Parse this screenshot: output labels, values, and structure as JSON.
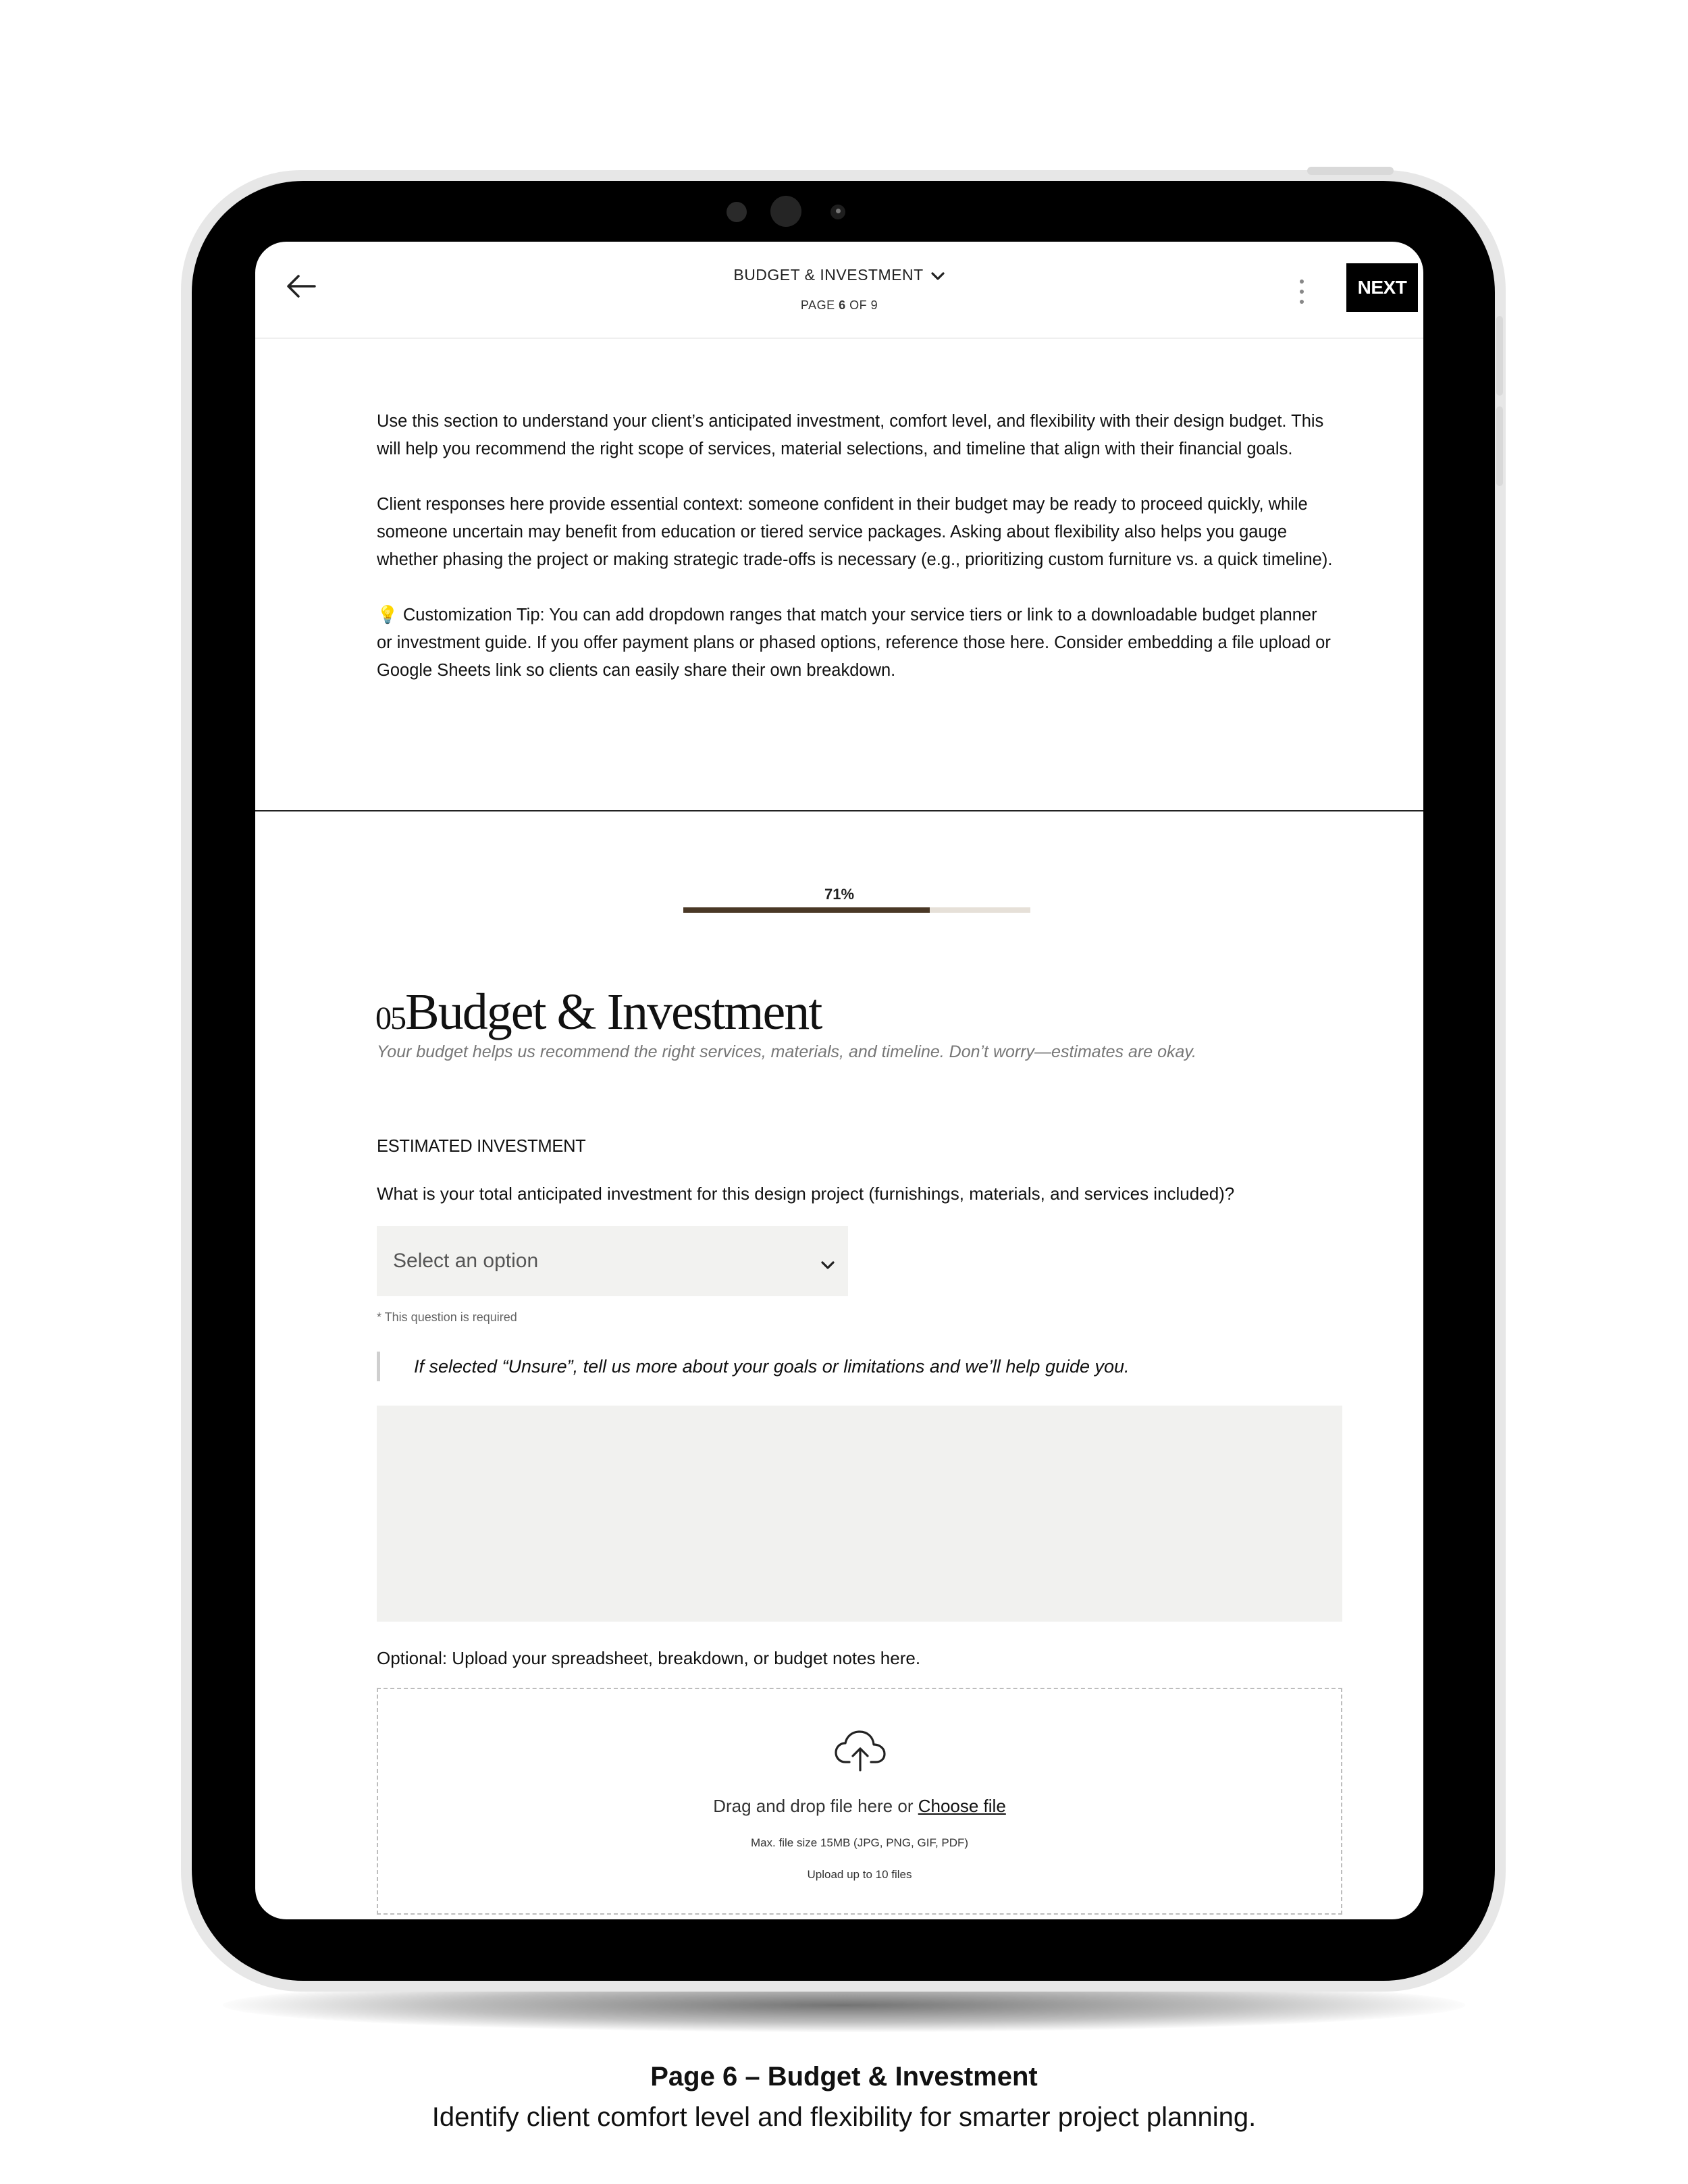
{
  "header": {
    "title": "BUDGET & INVESTMENT",
    "page_prefix": "PAGE ",
    "page_current": "6",
    "page_suffix": " OF 9",
    "next_label": "NEXT"
  },
  "intro": {
    "paragraph_1": "Use this section to understand your client’s anticipated investment, comfort level, and flexibility with their design budget. This will help you recommend the right scope of services, material selections, and timeline that align with their financial goals.",
    "paragraph_2": "Client responses here provide essential context: someone confident in their budget may be ready to proceed quickly, while someone uncertain may benefit from education or tiered service packages. Asking about flexibility also helps you gauge whether phasing the project or making strategic trade-offs is necessary (e.g., prioritizing custom furniture vs. a quick timeline).",
    "paragraph_3": "💡 Customization Tip: You can add dropdown ranges that match your service tiers or link to a downloadable budget planner or investment guide. If you offer payment plans or phased options, reference those here. Consider embedding a file upload or Google Sheets link so clients can easily share their own breakdown."
  },
  "progress": {
    "label": "71%",
    "value": 0.71
  },
  "section": {
    "number": "05",
    "title": "Budget & Investment",
    "subtitle": "Your budget helps us recommend the right services, materials, and timeline. Don’t worry—estimates are okay."
  },
  "form": {
    "field_label": "ESTIMATED INVESTMENT",
    "question": "What is your total anticipated investment for this design project (furnishings, materials, and services included)?",
    "select_placeholder": "Select an option",
    "required_note": "* This question is required",
    "unsure_prompt": "If selected “Unsure”, tell us more about your goals or limitations and we’ll help guide you.",
    "upload_label": "Optional: Upload your spreadsheet, breakdown, or budget notes here.",
    "drop_text": "Drag and drop file here or ",
    "choose_file": "Choose file",
    "max_size": "Max. file size 15MB (JPG, PNG, GIF, PDF)",
    "max_files": "Upload up to 10 files"
  },
  "caption": {
    "title": "Page 6 – Budget & Investment",
    "subtitle": "Identify client comfort level and flexibility for smarter project planning."
  },
  "colors": {
    "progress_fill": "#4a3826",
    "progress_track": "#e6e0d8",
    "next_button": "#000000",
    "input_background": "#f2f2f0"
  },
  "icons": {
    "back": "arrow-left-icon",
    "title_dropdown": "chevron-down-icon",
    "more": "more-vertical-icon",
    "select_dropdown": "chevron-down-icon",
    "upload": "cloud-upload-icon"
  }
}
